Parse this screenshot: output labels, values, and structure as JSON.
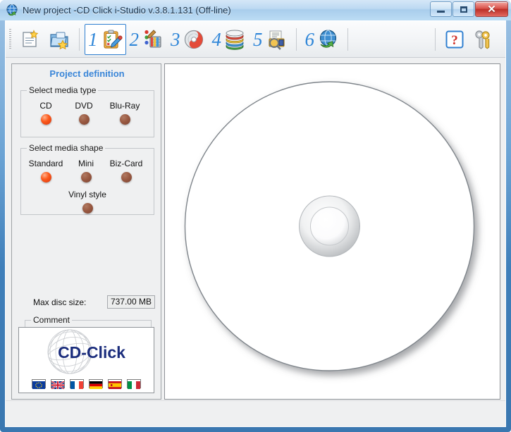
{
  "window": {
    "title": "New project -CD Click i-Studio v.3.8.1.131 (Off-line)",
    "icon": "globe-arrow-icon",
    "minimize_label": "–",
    "maximize_label": "□",
    "close_label": "✕",
    "accent_blue": "#3f7fba",
    "close_red": "#bc2f28"
  },
  "toolbar": {
    "new_project_label": "new-project",
    "open_project_label": "open-project",
    "steps": [
      {
        "number": "1",
        "name": "project-definition",
        "selected": true
      },
      {
        "number": "2",
        "name": "design",
        "selected": false
      },
      {
        "number": "3",
        "name": "disc-burn",
        "selected": false
      },
      {
        "number": "4",
        "name": "media-library",
        "selected": false
      },
      {
        "number": "5",
        "name": "preview-print",
        "selected": false
      },
      {
        "number": "6",
        "name": "publish-online",
        "selected": false
      }
    ],
    "help_label": "?",
    "key_label": "license-keys"
  },
  "left_panel": {
    "title": "Project definition",
    "media_type": {
      "legend": "Select media type",
      "options": [
        {
          "label": "CD",
          "selected": true
        },
        {
          "label": "DVD",
          "selected": false
        },
        {
          "label": "Blu-Ray",
          "selected": false
        }
      ]
    },
    "media_shape": {
      "legend": "Select media shape",
      "options": [
        {
          "label": "Standard",
          "selected": true
        },
        {
          "label": "Mini",
          "selected": false
        },
        {
          "label": "Biz-Card",
          "selected": false
        },
        {
          "label": "Vinyl style",
          "selected": false
        }
      ]
    },
    "max_disc_size": {
      "label": "Max disc size:",
      "value": "737.00 MB"
    },
    "comment": {
      "legend": "Comment",
      "value": "",
      "placeholder": ""
    },
    "logo": {
      "brand": "CD-Click",
      "flags": [
        {
          "name": "flag-eu",
          "title": "European Union"
        },
        {
          "name": "flag-uk",
          "title": "United Kingdom"
        },
        {
          "name": "flag-fr",
          "title": "France"
        },
        {
          "name": "flag-de",
          "title": "Germany"
        },
        {
          "name": "flag-es",
          "title": "Spain"
        },
        {
          "name": "flag-it",
          "title": "Italy"
        }
      ]
    }
  },
  "preview": {
    "name": "disc-preview",
    "disc_shape": "Standard",
    "disc_color": "#ffffff"
  }
}
